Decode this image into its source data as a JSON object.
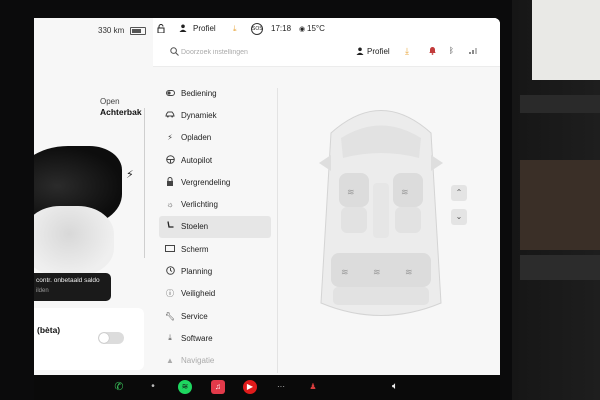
{
  "left_panel": {
    "range": "330 km",
    "trunk_action": "Open",
    "trunk_name": "Achterbak",
    "notification_title": "contr. onbetaald saldo",
    "notification_sub": "ilden",
    "beta_label": "(bèta)"
  },
  "status": {
    "profile": "Profiel",
    "sos": "SOS",
    "time": "17:18",
    "temperature": "15°C"
  },
  "search": {
    "placeholder": "Doorzoek instellingen",
    "profile": "Profiel"
  },
  "menu": [
    {
      "label": "Bediening",
      "icon": "toggle-icon"
    },
    {
      "label": "Dynamiek",
      "icon": "car-icon"
    },
    {
      "label": "Opladen",
      "icon": "bolt-icon"
    },
    {
      "label": "Autopilot",
      "icon": "steering-wheel-icon"
    },
    {
      "label": "Vergrendeling",
      "icon": "lock-icon"
    },
    {
      "label": "Verlichting",
      "icon": "sun-icon"
    },
    {
      "label": "Stoelen",
      "icon": "seat-icon",
      "active": true
    },
    {
      "label": "Scherm",
      "icon": "display-icon"
    },
    {
      "label": "Planning",
      "icon": "clock-icon"
    },
    {
      "label": "Veiligheid",
      "icon": "info-icon"
    },
    {
      "label": "Service",
      "icon": "wrench-icon"
    },
    {
      "label": "Software",
      "icon": "download-icon"
    },
    {
      "label": "Navigatie",
      "icon": "nav-icon"
    }
  ],
  "colors": {
    "accent_download": "#e8a53a",
    "alert": "#c23b3b",
    "active_menu_bg": "#e6e6e6"
  }
}
